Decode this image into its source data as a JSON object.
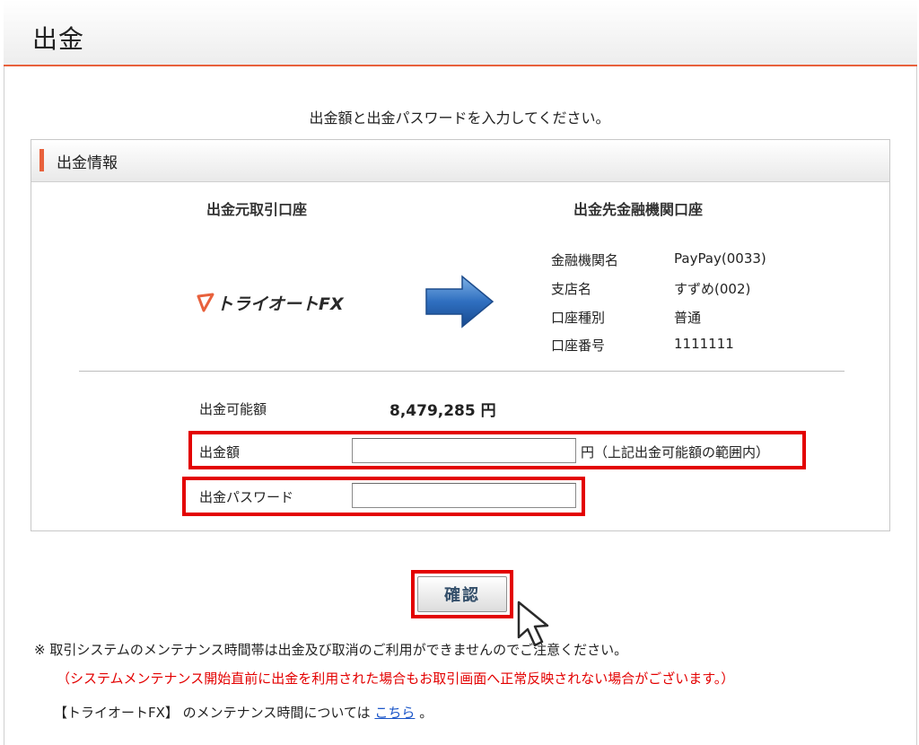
{
  "header": {
    "title": "出金"
  },
  "instruction": "出金額と出金パスワードを入力してください。",
  "panel": {
    "title": "出金情報",
    "source_heading": "出金元取引口座",
    "dest_heading": "出金先金融機関口座",
    "logo_text": "トライオートFX",
    "bank": [
      {
        "label": "金融機関名",
        "value": "PayPay(0033)"
      },
      {
        "label": "支店名",
        "value": "すずめ(002)"
      },
      {
        "label": "口座種別",
        "value": "普通"
      },
      {
        "label": "口座番号",
        "value": "1111111"
      }
    ],
    "available_label": "出金可能額",
    "available_value": "8,479,285 円",
    "amount_label": "出金額",
    "amount_value": "",
    "amount_note": "円（上記出金可能額の範囲内）",
    "password_label": "出金パスワード",
    "password_value": ""
  },
  "confirm_button": "確認",
  "notes": {
    "line1": "※ 取引システムのメンテナンス時間帯は出金及び取消のご利用ができませんのでご注意ください。",
    "line2": "（システムメンテナンス開始直前に出金を利用された場合もお取引画面へ正常反映されない場合がございます。）",
    "line3_prefix": "【トライオートFX】 のメンテナンス時間については",
    "line3_link": "こちら",
    "line3_suffix": "。"
  },
  "colors": {
    "accent": "#e8613c",
    "highlight": "#e30000",
    "link": "#1a55c8"
  }
}
